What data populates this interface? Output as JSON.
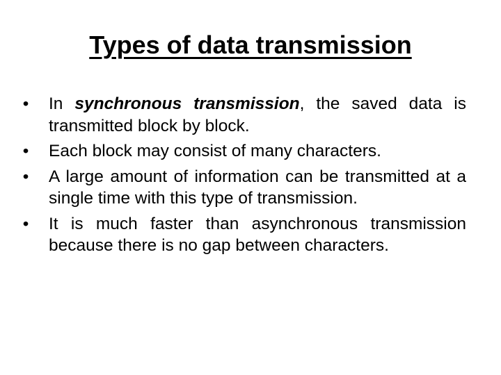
{
  "slide": {
    "title": "Types of data transmission",
    "bullet_glyph": "•",
    "bullets": [
      {
        "prefix": "In ",
        "emphasis": "synchronous transmission",
        "suffix": ", the saved data is transmitted block by block."
      },
      {
        "text": "Each block may consist of many characters."
      },
      {
        "text": "A large amount of information can be transmitted at a single time with this type of transmission."
      },
      {
        "text": "It is much faster than asynchronous transmission because there is no gap between characters."
      }
    ]
  }
}
